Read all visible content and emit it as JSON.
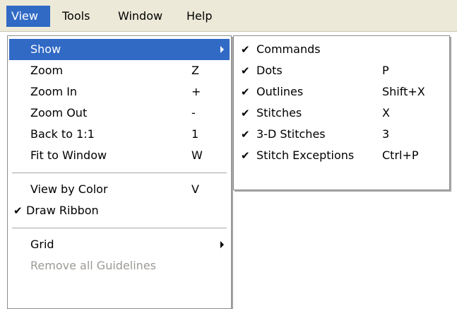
{
  "menubar": {
    "items": [
      "View",
      "Tools",
      "Window",
      "Help"
    ]
  },
  "view_menu": {
    "items": [
      {
        "label": "Show",
        "shortcut": ""
      },
      {
        "label": "Zoom",
        "shortcut": "Z"
      },
      {
        "label": "Zoom In",
        "shortcut": "+"
      },
      {
        "label": "Zoom Out",
        "shortcut": "-"
      },
      {
        "label": "Back to 1:1",
        "shortcut": "1"
      },
      {
        "label": "Fit to Window",
        "shortcut": "W"
      },
      {
        "label": "View by Color",
        "shortcut": "V"
      },
      {
        "label": "Draw Ribbon",
        "shortcut": "",
        "checked": true
      },
      {
        "label": "Grid",
        "shortcut": ""
      },
      {
        "label": "Remove all Guidelines",
        "shortcut": "",
        "disabled": true
      }
    ]
  },
  "show_submenu": {
    "items": [
      {
        "label": "Commands",
        "shortcut": "",
        "checked": true
      },
      {
        "label": "Dots",
        "shortcut": "P",
        "checked": true
      },
      {
        "label": "Outlines",
        "shortcut": "Shift+X",
        "checked": true
      },
      {
        "label": "Stitches",
        "shortcut": "X",
        "checked": true
      },
      {
        "label": "3-D Stitches",
        "shortcut": "3",
        "checked": true
      },
      {
        "label": "Stitch Exceptions",
        "shortcut": "Ctrl+P",
        "checked": true
      }
    ]
  },
  "glyphs": {
    "check": "✔"
  },
  "colors": {
    "highlight": "#316ac5",
    "menubar": "#ece9d8",
    "disabled": "#9c9a94"
  }
}
